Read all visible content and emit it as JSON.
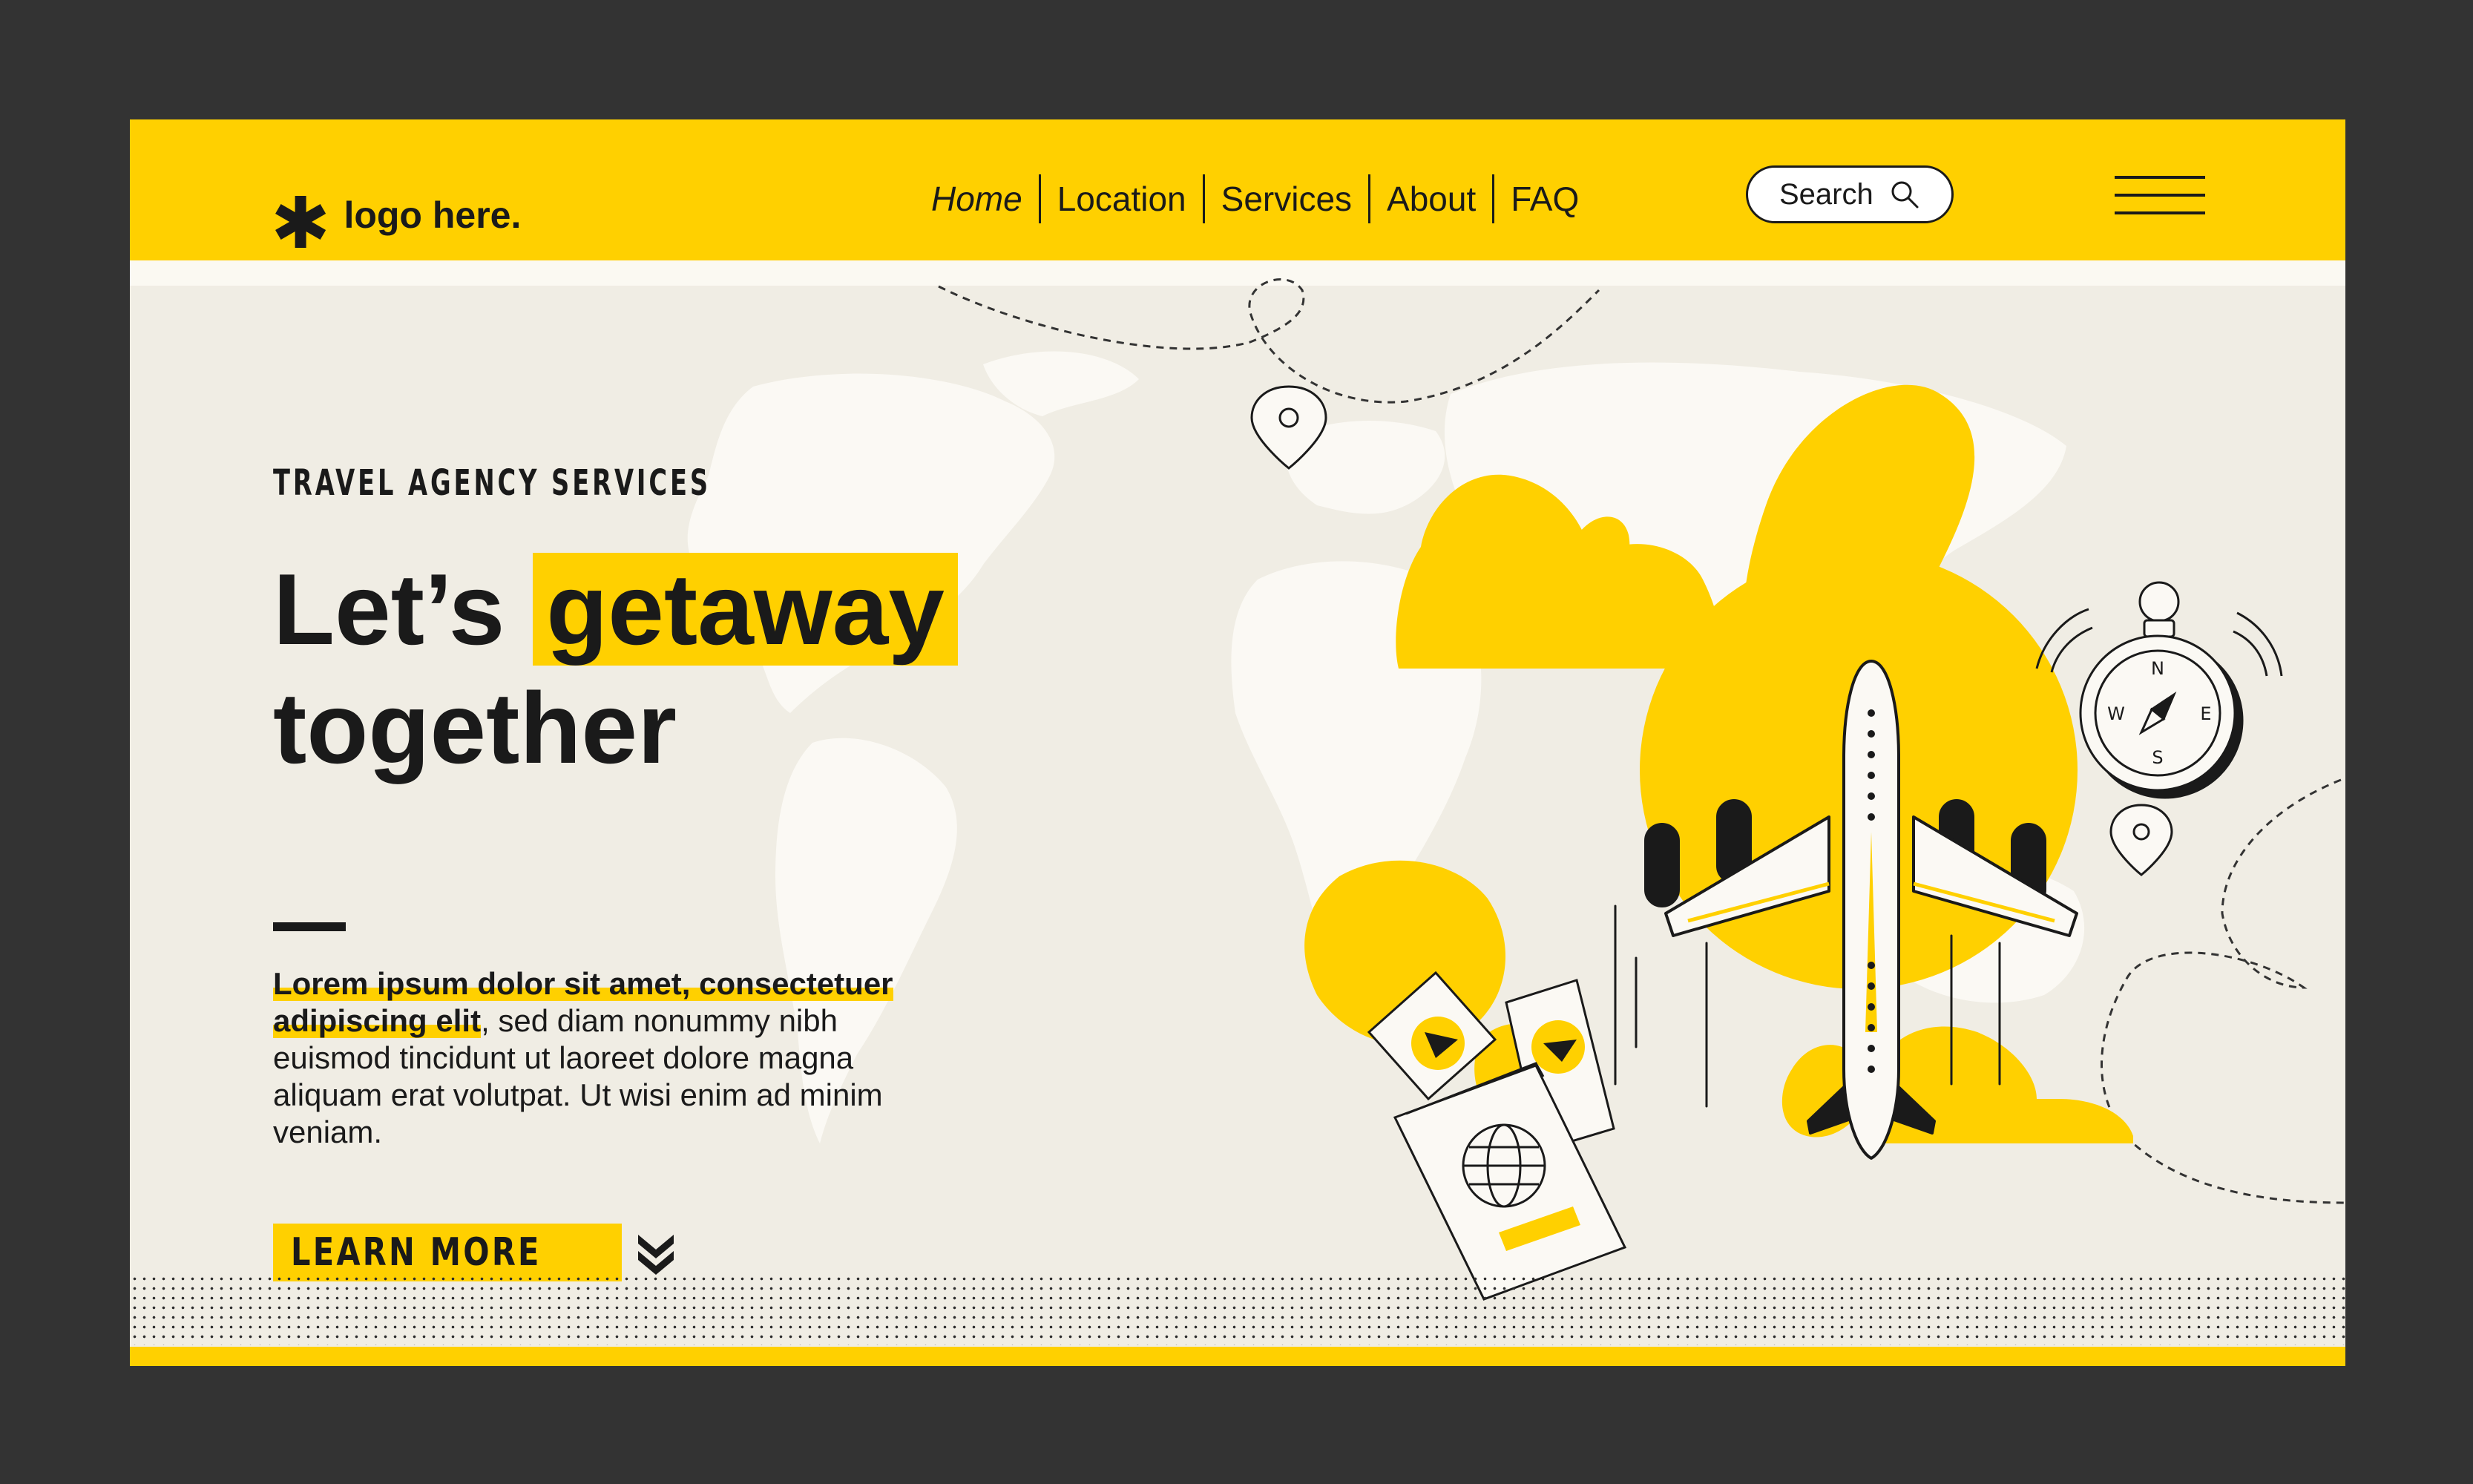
{
  "logo": {
    "mark": "✱",
    "text": "logo here."
  },
  "nav": {
    "items": [
      {
        "label": "Home"
      },
      {
        "label": "Location"
      },
      {
        "label": "Services"
      },
      {
        "label": "About"
      },
      {
        "label": "FAQ"
      }
    ]
  },
  "search": {
    "label": "Search"
  },
  "hero": {
    "eyebrow": "TRAVEL AGENCY SERVICES",
    "title_prefix": "Let’s",
    "title_highlight": "getaway",
    "title_line2": "together",
    "body_highlight": "Lorem ipsum dolor sit amet, consectetuer adipiscing elit",
    "body_rest": ", sed diam nonummy nibh euismod tincidunt ut laoreet dolore magna aliquam erat volutpat. Ut wisi enim ad minim veniam.",
    "cta_label": "LEARN MORE"
  },
  "compass": {
    "n": "N",
    "e": "E",
    "s": "S",
    "w": "W"
  },
  "colors": {
    "accent": "#ffd000",
    "dark": "#1a1a1a",
    "frame": "#333333",
    "background": "#f0ede4"
  },
  "icons": [
    "asterisk-logo-icon",
    "search-icon",
    "hamburger-menu-icon",
    "double-chevron-down-icon",
    "airplane-illustration",
    "compass-icon",
    "ticket-icon",
    "passport-icon",
    "location-pin-icon",
    "cloud-icon",
    "world-map"
  ]
}
